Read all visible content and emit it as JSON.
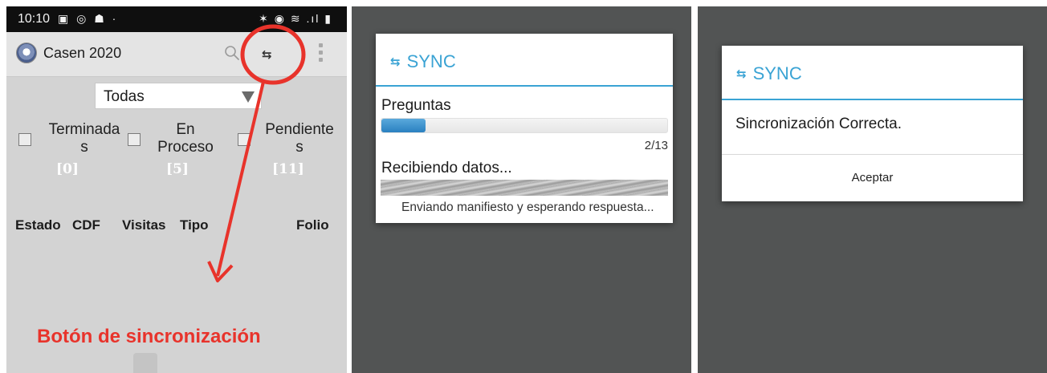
{
  "screen_home": {
    "status_bar": {
      "time": "10:10",
      "left_icons": "▣ ◎ ☗ ·",
      "right_icons": "✶ ◉ ≋ .ıl ▮"
    },
    "app_bar": {
      "title": "Casen 2020",
      "logo_icon": "app-logo-icon",
      "search_icon": "search-icon",
      "sync_icon": "sync-icon",
      "menu_icon": "overflow-menu-icon"
    },
    "filter_select": {
      "value": "Todas"
    },
    "status_filters": [
      {
        "label_line1": "Terminada",
        "label_line2": "s",
        "count": "[0]",
        "checked": false
      },
      {
        "label_line1": "En",
        "label_line2": "Proceso",
        "count": "[5]",
        "checked": false
      },
      {
        "label_line1": "Pendiente",
        "label_line2": "s",
        "count": "[11]",
        "checked": false
      }
    ],
    "table_headers": [
      "Estado",
      "CDF",
      "Visitas",
      "Tipo",
      "Folio"
    ],
    "annotation": {
      "text": "Botón de sincronización",
      "color": "#e8332b"
    }
  },
  "sync_progress_dialog": {
    "title": "SYNC",
    "title_icon": "sync-icon",
    "questions_label": "Preguntas",
    "questions_progress": {
      "current": 2,
      "total": 13,
      "text": "2/13"
    },
    "receiving_label": "Recibiendo datos...",
    "status_message": "Enviando manifiesto y esperando respuesta..."
  },
  "sync_result_dialog": {
    "title": "SYNC",
    "title_icon": "sync-icon",
    "message": "Sincronización Correcta.",
    "button_label": "Aceptar"
  },
  "colors": {
    "accent": "#3aa3d4",
    "dim_background": "#525454",
    "screen_background": "#d3d3d3"
  }
}
